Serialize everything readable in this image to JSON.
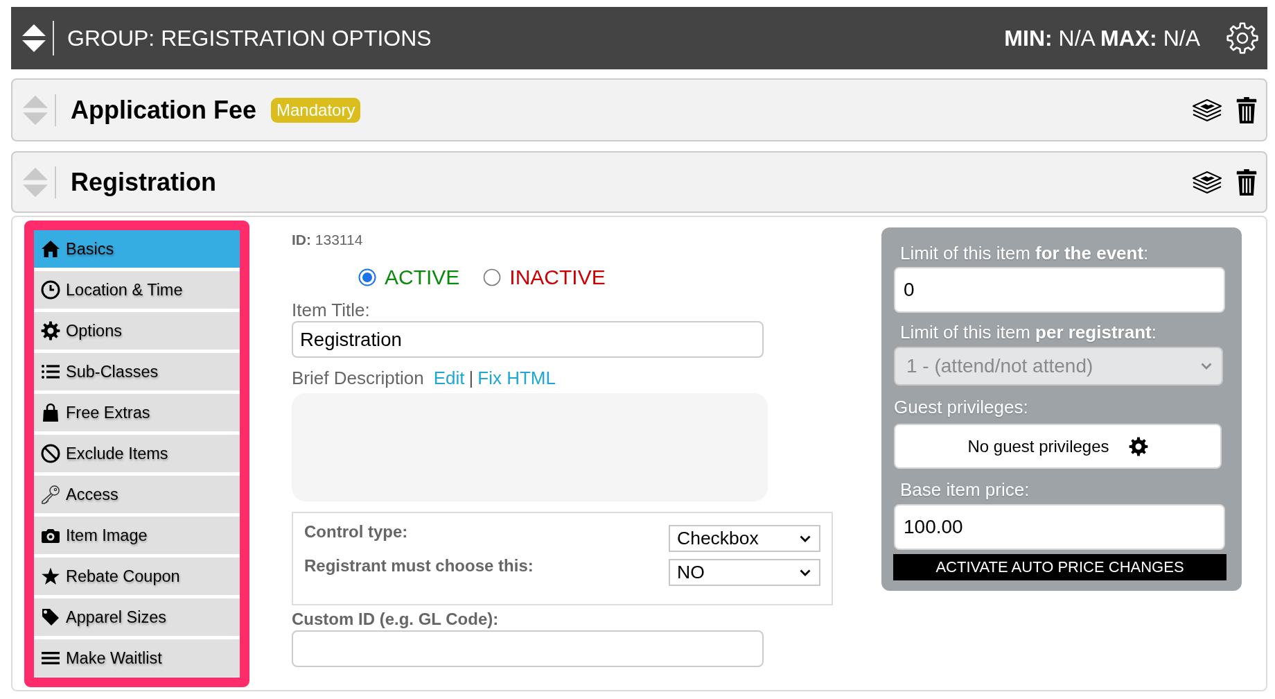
{
  "group_header": {
    "title": "GROUP: REGISTRATION OPTIONS",
    "limits": "**MIN:** N/A **MAX:** N/A"
  },
  "items": [
    {
      "title": "Application Fee",
      "badge": "Mandatory"
    },
    {
      "title": "Registration"
    }
  ],
  "editor": {
    "sidebar": [
      {
        "label": "Basics",
        "selected": true
      },
      {
        "label": "Location & Time",
        "selected": false
      },
      {
        "label": "Options",
        "selected": false
      },
      {
        "label": "Sub-Classes",
        "selected": false
      },
      {
        "label": "Free Extras",
        "selected": false
      },
      {
        "label": "Exclude Items",
        "selected": false
      },
      {
        "label": "Access",
        "selected": false
      },
      {
        "label": "Item Image",
        "selected": false
      },
      {
        "label": "Rebate Coupon",
        "selected": false
      },
      {
        "label": "Apparel Sizes",
        "selected": false
      },
      {
        "label": "Make Waitlist",
        "selected": false
      }
    ],
    "id_text": "**ID:** 133114",
    "status": [
      {
        "label": "ACTIVE",
        "selected": true,
        "color": "#0a8a0a"
      },
      {
        "label": "INACTIVE",
        "selected": false,
        "color": "#cc0000"
      }
    ],
    "item_title": {
      "label": "Item Title:",
      "value": "Registration"
    },
    "description": {
      "label": "Brief Description",
      "links": [
        "Edit",
        "Fix HTML"
      ],
      "separator": "|"
    },
    "control_settings": [
      {
        "label": "Control type:",
        "value": "Checkbox"
      },
      {
        "label": "Registrant must choose this:",
        "value": "NO"
      }
    ],
    "custom_id": {
      "label": "Custom ID (e.g. GL Code):"
    },
    "limits_panel": {
      "event_limit": {
        "label": "Limit of this item **for the event**:",
        "value": "0"
      },
      "registrant_limit": {
        "label": "Limit of this item **per registrant**:",
        "value": "1 - (attend/not attend)",
        "disabled": true
      },
      "guest_privileges": {
        "label": "Guest privileges:",
        "value": "No guest privileges"
      },
      "base_price": {
        "label": "Base item price:",
        "value": "100.00"
      },
      "auto_price_button": "ACTIVATE AUTO PRICE CHANGES"
    }
  }
}
